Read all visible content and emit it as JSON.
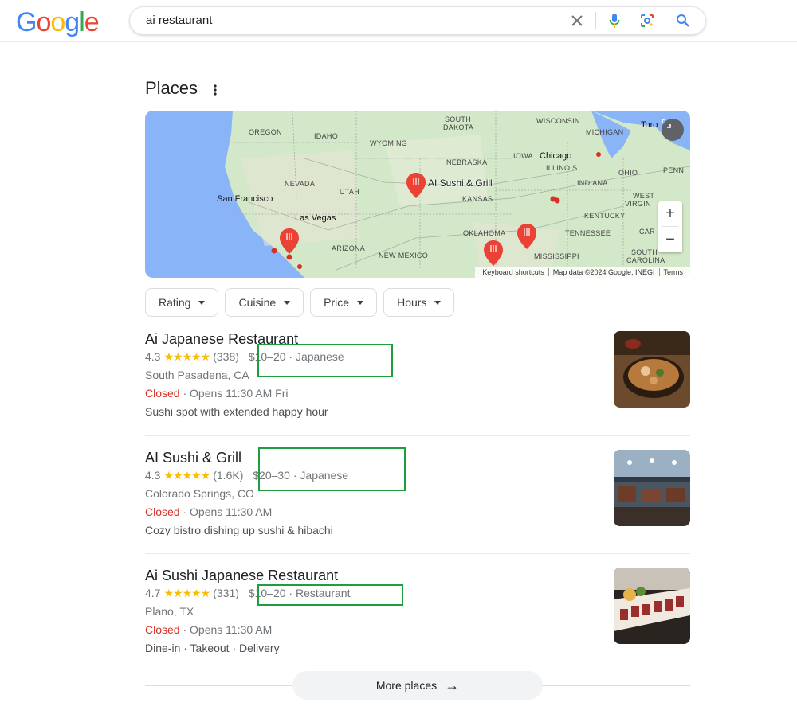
{
  "search": {
    "query": "ai restaurant"
  },
  "section": {
    "title": "Places"
  },
  "map": {
    "labels": {
      "oregon": "OREGON",
      "idaho": "IDAHO",
      "wyoming": "WYOMING",
      "south_dakota_1": "SOUTH",
      "south_dakota_2": "DAKOTA",
      "wisconsin": "WISCONSIN",
      "michigan": "MICHIGAN",
      "nebraska": "NEBRASKA",
      "iowa": "IOWA",
      "illinois": "ILLINOIS",
      "nevada": "NEVADA",
      "utah": "UTAH",
      "kansas": "KANSAS",
      "indiana": "INDIANA",
      "ohio": "OHIO",
      "penn": "PENN",
      "west_virginia_1": "WEST",
      "west_virginia_2": "VIRGIN",
      "kentucky": "KENTUCKY",
      "tennessee": "TENNESSEE",
      "oklahoma": "OKLAHOMA",
      "arizona": "ARIZONA",
      "new_mexico": "NEW MEXICO",
      "mississippi": "MISSISSIPPI",
      "carolina_1": "SOUTH",
      "carolina_2": "CAROLINA",
      "car": "CAR"
    },
    "cities": {
      "chicago": "Chicago",
      "san_francisco": "San Francisco",
      "las_vegas": "Las Vegas",
      "toronto": "Toro"
    },
    "pin_label": "AI Sushi & Grill",
    "footer": {
      "shortcuts": "Keyboard shortcuts",
      "mapdata": "Map data ©2024 Google, INEGI",
      "terms": "Terms"
    },
    "zoom_in": "+",
    "zoom_out": "−"
  },
  "filters": [
    "Rating",
    "Cuisine",
    "Price",
    "Hours"
  ],
  "places": [
    {
      "name": "Ai Japanese Restaurant",
      "rating": "4.3",
      "stars": 4.3,
      "reviews": "(338)",
      "price_type": "$10–20 · Japanese",
      "address": "South Pasadena, CA",
      "status": "Closed",
      "hours": " · Opens 11:30 AM Fri",
      "desc": "Sushi spot with extended happy hour"
    },
    {
      "name": "AI Sushi & Grill",
      "rating": "4.3",
      "stars": 4.3,
      "reviews": "(1.6K)",
      "price_type": "$20–30 · Japanese",
      "address": "Colorado Springs, CO",
      "status": "Closed",
      "hours": " · Opens 11:30 AM",
      "desc": "Cozy bistro dishing up sushi & hibachi"
    },
    {
      "name": "Ai Sushi Japanese Restaurant",
      "rating": "4.7",
      "stars": 4.7,
      "reviews": "(331)",
      "price_type": "$10–20 · Restaurant",
      "address": "Plano, TX",
      "status": "Closed",
      "hours": " · Opens 11:30 AM",
      "desc": "Dine-in · Takeout · Delivery"
    }
  ],
  "more_places": "More places",
  "stars_glyph": "★★★★★",
  "colors": {
    "star": "#fbbc04",
    "closed": "#d93025",
    "highlight": "#1e9e3e",
    "pin": "#ea4335"
  }
}
